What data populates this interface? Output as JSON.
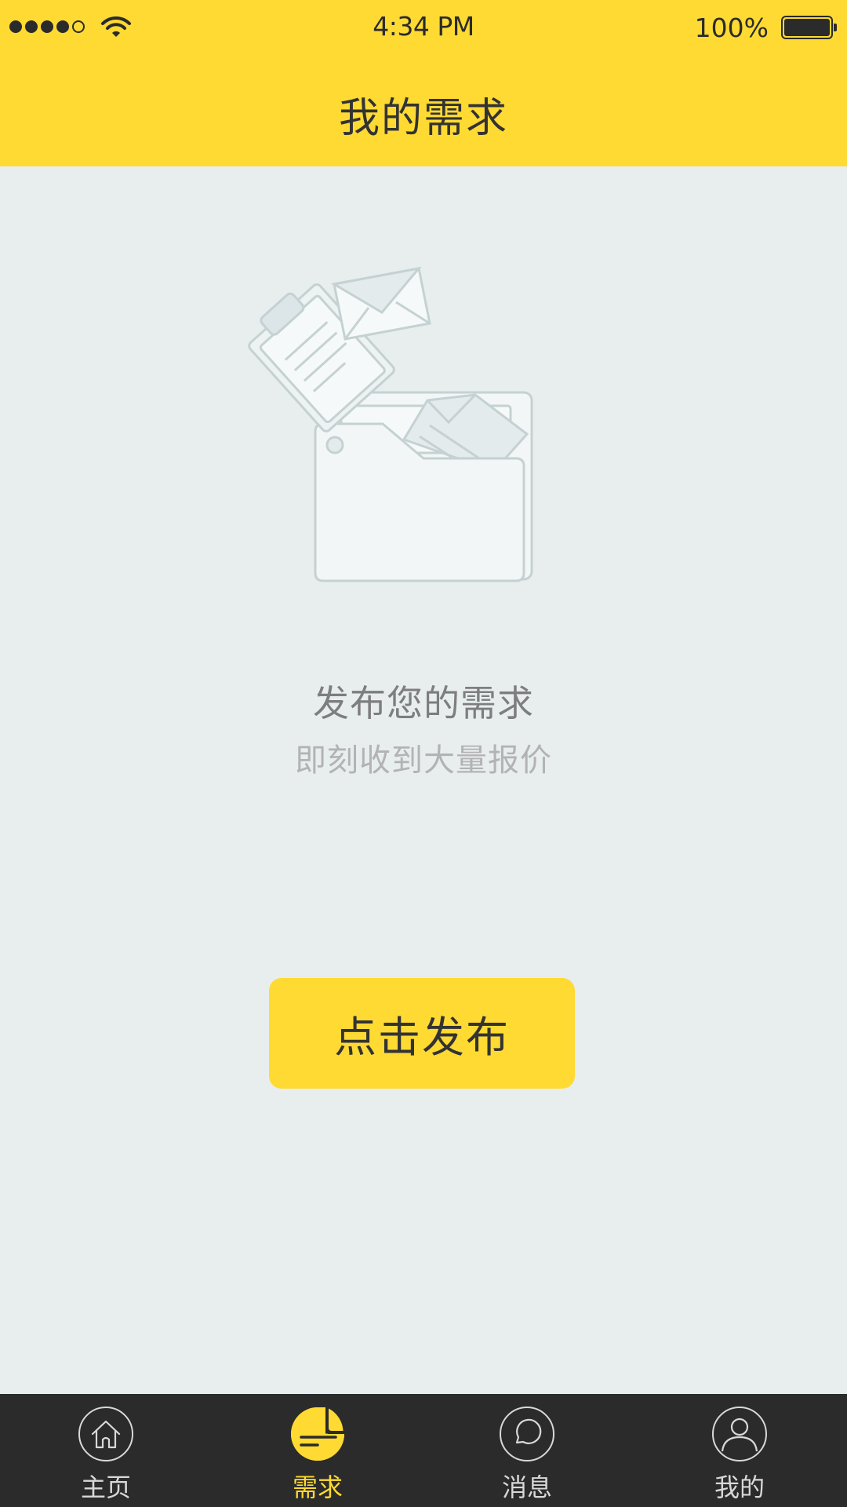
{
  "status_bar": {
    "signal_bars": 5,
    "signal_filled": 4,
    "time": "4:34 PM",
    "battery_percent": "100%"
  },
  "header": {
    "title": "我的需求"
  },
  "empty_state": {
    "illustration_icon": "folder-documents-illustration",
    "title": "发布您的需求",
    "subtitle": "即刻收到大量报价"
  },
  "actions": {
    "publish_label": "点击发布"
  },
  "tabbar": {
    "active_index": 1,
    "tabs": [
      {
        "label": "主页",
        "icon": "home-icon"
      },
      {
        "label": "需求",
        "icon": "requirements-icon"
      },
      {
        "label": "消息",
        "icon": "message-icon"
      },
      {
        "label": "我的",
        "icon": "profile-icon"
      }
    ]
  },
  "colors": {
    "accent": "#FFDA33",
    "background": "#E8EEEE",
    "tabbar": "#2B2B2B",
    "text_dark": "#333333",
    "text_gray": "#7E7E7E",
    "text_light": "#B3B3B3"
  }
}
